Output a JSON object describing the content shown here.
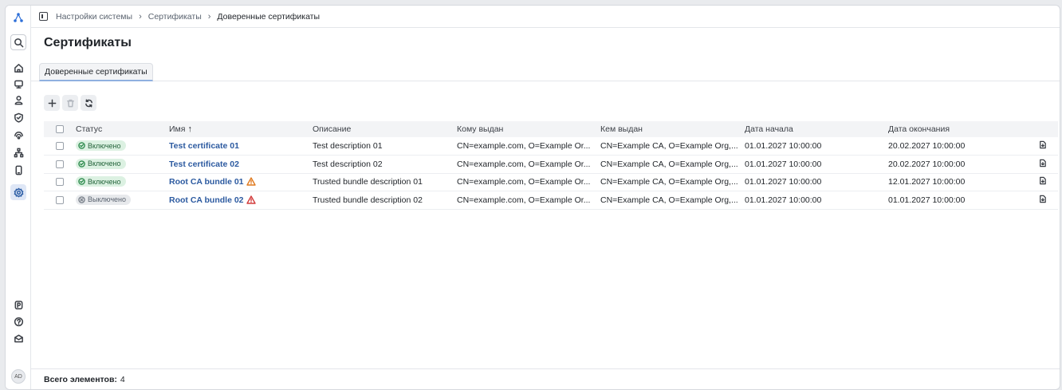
{
  "breadcrumb": {
    "items": [
      "Настройки системы",
      "Сертификаты"
    ],
    "current": "Доверенные сертификаты"
  },
  "page": {
    "title": "Сертификаты"
  },
  "tabs": [
    {
      "label": "Доверенные сертификаты",
      "active": true
    }
  ],
  "toolbar": {
    "add_icon": "plus-icon",
    "delete_icon": "trash-icon",
    "refresh_icon": "refresh-icon"
  },
  "table": {
    "columns": {
      "status": "Статус",
      "name": "Имя",
      "description": "Описание",
      "issued_to": "Кому выдан",
      "issued_by": "Кем выдан",
      "start_date": "Дата начала",
      "end_date": "Дата окончания"
    },
    "sort": {
      "column": "name",
      "direction": "asc"
    },
    "rows": [
      {
        "status": "Включено",
        "enabled": true,
        "name": "Test certificate 01",
        "warning": "none",
        "description": "Test description 01",
        "issued_to": "CN=example.com, O=Example Or...",
        "issued_by": "CN=Example CA, O=Example Org,...",
        "start_date": "01.01.2027 10:00:00",
        "end_date": "20.02.2027 10:00:00"
      },
      {
        "status": "Включено",
        "enabled": true,
        "name": "Test certificate 02",
        "warning": "none",
        "description": "Test description 02",
        "issued_to": "CN=example.com, O=Example Or...",
        "issued_by": "CN=Example CA, O=Example Org,...",
        "start_date": "01.01.2027 10:00:00",
        "end_date": "20.02.2027 10:00:00"
      },
      {
        "status": "Включено",
        "enabled": true,
        "name": "Root CA bundle 01",
        "warning": "warning",
        "description": "Trusted bundle description 01",
        "issued_to": "CN=example.com, O=Example Or...",
        "issued_by": "CN=Example CA, O=Example Org,...",
        "start_date": "01.01.2027 10:00:00",
        "end_date": "12.01.2027 10:00:00"
      },
      {
        "status": "Выключено",
        "enabled": false,
        "name": "Root CA bundle 02",
        "warning": "error",
        "description": "Trusted bundle description 02",
        "issued_to": "CN=example.com, O=Example Or...",
        "issued_by": "CN=Example CA, O=Example Org,...",
        "start_date": "01.01.2027 10:00:00",
        "end_date": "01.01.2027 10:00:00"
      }
    ]
  },
  "footer": {
    "total_label": "Всего элементов:",
    "total_value": "4"
  },
  "user": {
    "initials": "AD"
  },
  "colors": {
    "accent": "#2c5aa0",
    "enabled_badge": "#dcf1e2",
    "disabled_badge": "#e7e9ec",
    "warning": "#e07a1f",
    "error": "#d23b3b"
  },
  "sidebar": {
    "icons": [
      "app-logo-icon",
      "search-icon",
      "home-icon",
      "monitor-icon",
      "users-icon",
      "shield-icon",
      "network-icon",
      "topology-icon",
      "device-icon",
      "settings-icon",
      "license-icon",
      "help-icon",
      "mail-icon"
    ]
  }
}
